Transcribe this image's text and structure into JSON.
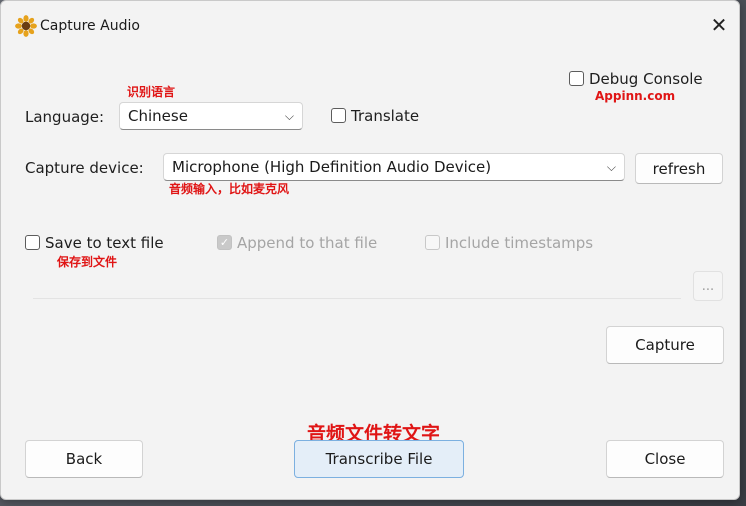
{
  "window": {
    "title": "Capture Audio",
    "close_glyph": "✕"
  },
  "language": {
    "label": "Language:",
    "value": "Chinese",
    "annotation": "识别语言"
  },
  "translate": {
    "label": "Translate",
    "checked": false
  },
  "debug_console": {
    "label": "Debug Console",
    "checked": false,
    "annotation": "Appinn.com"
  },
  "capture_device": {
    "label": "Capture device:",
    "value": "Microphone (High Definition Audio Device)",
    "annotation": "音频输入，比如麦克风",
    "refresh_label": "refresh"
  },
  "save_to_file": {
    "label": "Save to text file",
    "checked": false,
    "annotation": "保存到文件"
  },
  "append": {
    "label": "Append to that file",
    "checked": true,
    "disabled": true
  },
  "timestamps": {
    "label": "Include timestamps",
    "checked": false,
    "disabled": true
  },
  "browse_label": "...",
  "capture_label": "Capture",
  "footer": {
    "back_label": "Back",
    "transcribe_label": "Transcribe File",
    "transcribe_annotation": "音频文件转文字",
    "close_label": "Close"
  },
  "icons": {
    "app": "sunflower-icon",
    "dropdown": "chevron-down-icon",
    "check": "checkmark-icon"
  },
  "colors": {
    "annotation_red": "#e01515",
    "primary_border": "#7cb0e0",
    "window_bg": "#f3f3f3"
  }
}
